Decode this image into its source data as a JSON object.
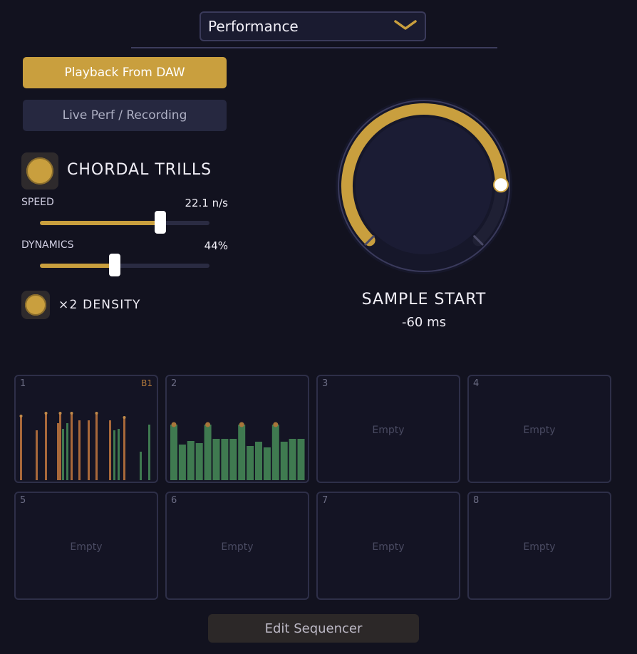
{
  "preset": {
    "selected": "Performance",
    "icon": "chevron-down-icon"
  },
  "modes": {
    "daw_label": "Playback From DAW",
    "live_label": "Live Perf / Recording"
  },
  "trills": {
    "title": "CHORDAL TRILLS",
    "enabled": true,
    "speed": {
      "label": "SPEED",
      "value": "22.1 n/s",
      "fraction": 0.71
    },
    "dynamics": {
      "label": "DYNAMICS",
      "value": "44%",
      "fraction": 0.44
    }
  },
  "density": {
    "label": "×2 DENSITY",
    "enabled": true
  },
  "knob": {
    "label": "SAMPLE START",
    "value": "-60 ms",
    "fraction": 0.83
  },
  "pads": [
    {
      "num": "1",
      "tag": "B1",
      "empty_label": "",
      "content": "orange"
    },
    {
      "num": "2",
      "tag": "",
      "empty_label": "",
      "content": "green"
    },
    {
      "num": "3",
      "tag": "",
      "empty_label": "Empty",
      "content": "empty"
    },
    {
      "num": "4",
      "tag": "",
      "empty_label": "Empty",
      "content": "empty"
    },
    {
      "num": "5",
      "tag": "",
      "empty_label": "Empty",
      "content": "empty"
    },
    {
      "num": "6",
      "tag": "",
      "empty_label": "Empty",
      "content": "empty"
    },
    {
      "num": "7",
      "tag": "",
      "empty_label": "Empty",
      "content": "empty"
    },
    {
      "num": "8",
      "tag": "",
      "empty_label": "Empty",
      "content": "empty"
    }
  ],
  "edit_button": "Edit Sequencer",
  "colors": {
    "accent": "#c99f3e",
    "background": "#12121f",
    "green": "#3f7a50",
    "orange": "#a8683a"
  }
}
